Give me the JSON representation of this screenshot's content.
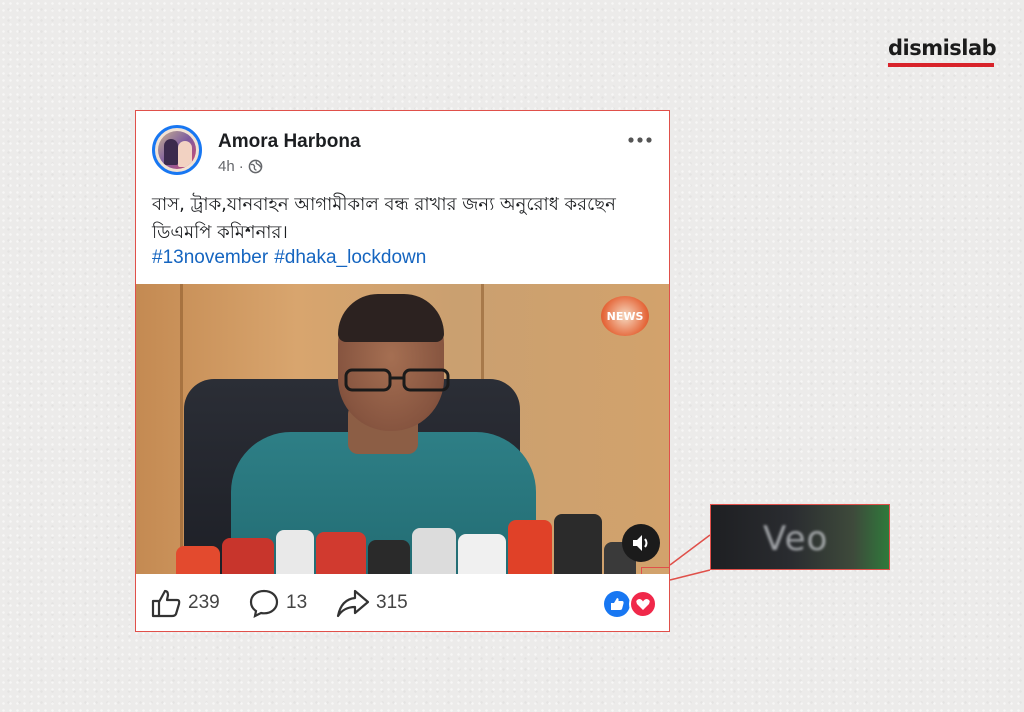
{
  "brand": {
    "logo_text": "dismislab",
    "accent_color": "#d8232a"
  },
  "post": {
    "author": "Amora Harbona",
    "time": "4h",
    "visibility_icon": "globe-icon",
    "caption": "বাস, ট্রাক,যানবাহন আগামীকাল বন্ধ রাখার জন্য অনুরোধ করছেন ডিএমপি কমিশনার।",
    "hashtags": [
      "#13november",
      "#dhaka_lockdown"
    ],
    "media": {
      "channel_logo": "NEWS"
    },
    "actions": {
      "likes": "239",
      "comments": "13",
      "shares": "315"
    }
  },
  "zoom_inset": {
    "text": "Veo"
  },
  "colors": {
    "hashtag": "#1565c0",
    "highlight_border": "#e0504a",
    "like_blue": "#1877f2",
    "love_red": "#f0284a"
  }
}
